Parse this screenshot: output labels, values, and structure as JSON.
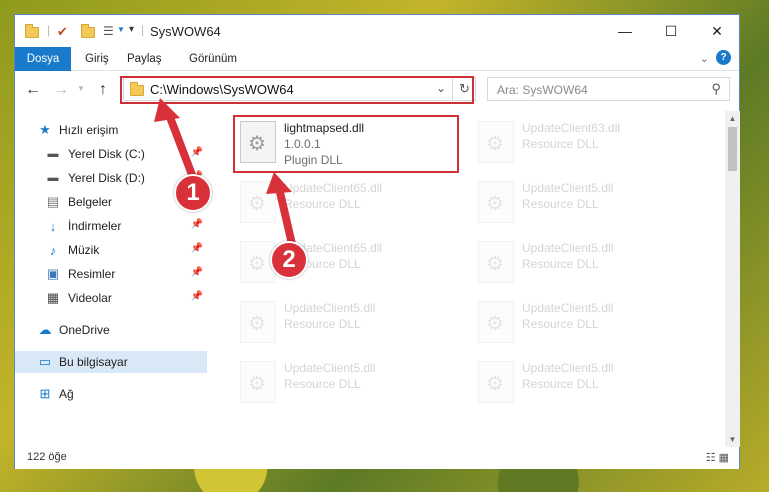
{
  "window": {
    "title": "SysWOW64",
    "controls": {
      "minimize": "—",
      "maximize": "☐",
      "close": "✕"
    }
  },
  "ribbon": {
    "tabs": [
      "Dosya",
      "Giriş",
      "Paylaş",
      "Görünüm"
    ],
    "expand_icon": "chevron-down-icon",
    "help_icon": "help-icon"
  },
  "address_bar": {
    "path": "C:\\Windows\\SysWOW64",
    "search_placeholder": "Ara: SysWOW64"
  },
  "sidebar": {
    "items": [
      {
        "label": "Hızlı erişim",
        "icon": "star-icon",
        "pinned": false
      },
      {
        "label": "Yerel Disk (C:)",
        "icon": "drive-icon",
        "pinned": true
      },
      {
        "label": "Yerel Disk (D:)",
        "icon": "drive-icon",
        "pinned": true
      },
      {
        "label": "Belgeler",
        "icon": "documents-icon",
        "pinned": true
      },
      {
        "label": "İndirmeler",
        "icon": "download-icon",
        "pinned": true
      },
      {
        "label": "Müzik",
        "icon": "music-icon",
        "pinned": true
      },
      {
        "label": "Resimler",
        "icon": "pictures-icon",
        "pinned": true
      },
      {
        "label": "Videolar",
        "icon": "videos-icon",
        "pinned": true
      },
      {
        "label": "OneDrive",
        "icon": "cloud-icon",
        "pinned": false
      },
      {
        "label": "Bu bilgisayar",
        "icon": "computer-icon",
        "pinned": false
      },
      {
        "label": "Ağ",
        "icon": "network-icon",
        "pinned": false
      }
    ]
  },
  "files": [
    {
      "name": "lightmapsed.dll",
      "version": "1.0.0.1",
      "type": "Plugin DLL",
      "highlighted": true
    },
    {
      "name": "UpdateClient63.dll",
      "version": "",
      "type": "Resource DLL",
      "highlighted": false
    },
    {
      "name": "UpdateClient65.dll",
      "version": "",
      "type": "Resource DLL",
      "highlighted": false
    },
    {
      "name": "UpdateClient5.dll",
      "version": "",
      "type": "Resource DLL",
      "highlighted": false
    },
    {
      "name": "UpdateClient65.dll",
      "version": "",
      "type": "Resource DLL",
      "highlighted": false
    },
    {
      "name": "UpdateClient5.dll",
      "version": "",
      "type": "Resource DLL",
      "highlighted": false
    },
    {
      "name": "UpdateClient5.dll",
      "version": "",
      "type": "Resource DLL",
      "highlighted": false
    },
    {
      "name": "UpdateClient5.dll",
      "version": "",
      "type": "Resource DLL",
      "highlighted": false
    },
    {
      "name": "UpdateClient5.dll",
      "version": "",
      "type": "Resource DLL",
      "highlighted": false
    },
    {
      "name": "UpdateClient5.dll",
      "version": "",
      "type": "Resource DLL",
      "highlighted": false
    }
  ],
  "status_bar": {
    "item_count": "122 öğe"
  },
  "annotations": {
    "step1": "1",
    "step2": "2",
    "color": "#d8313a"
  }
}
